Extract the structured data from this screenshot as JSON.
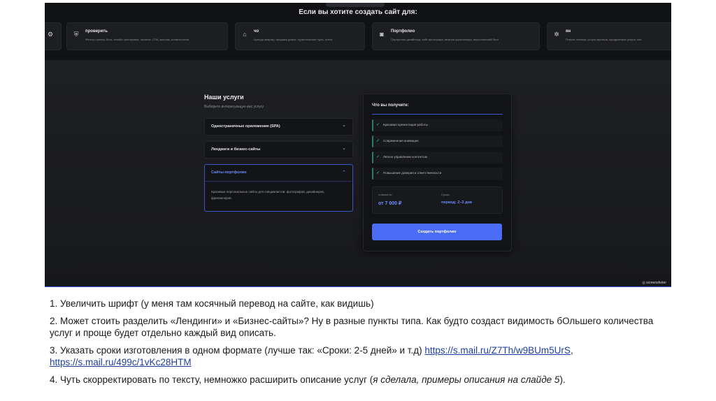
{
  "top": {
    "title": "Если вы хотите создать сайт для:",
    "categories": [
      {
        "icon": "shield-icon",
        "title": "проверить",
        "desc": "Фитнес-тренер, йога, онлайн-тренировки, питание, СПА, массаж, косметология"
      },
      {
        "icon": "house-icon",
        "title": "чо",
        "desc": "Аренда квартир, продажа домов, туристические туры, отели"
      },
      {
        "icon": "camera-icon",
        "title": "Портфолио",
        "desc": "Портфолио дизайнера, сайт фотографа, визитка фрилансера, персональный блог"
      },
      {
        "icon": "gears-icon",
        "title": "ян",
        "desc": "Ремонт техники, услуги мастера, юридические услуги, кли"
      }
    ]
  },
  "services": {
    "title": "Наши услуги",
    "subtitle": "Выберите интересующую вас услугу",
    "items": [
      {
        "label": "Одностраничные приложения (SPA)"
      },
      {
        "label": "Лендинги и бизнес-сайты"
      },
      {
        "label": "Сайты-портфолио",
        "body": "Красивые персональные сайты для специалистов: фотографов, дизайнеров, фрилансеров."
      }
    ]
  },
  "card": {
    "title": "Что вы получите:",
    "features": [
      "Красивая презентация работы",
      "Современная анимация",
      "Лёгкое управление контентом",
      "Повышение доверия и ответственности"
    ],
    "price_label": "стоимость:",
    "price_value": "от 7 000 ₽",
    "term_label": "Сроки:",
    "term_value": "период: 2–3 дня",
    "cta": "Создать портфолио"
  },
  "watermark": "◎ screenshoter",
  "notes": {
    "n1": "1. Увеличить шрифт (у меня там косячный перевод на сайте, как видишь)",
    "n2": "2. Может стоить разделить «Лендинги» и «Бизнес-сайты»? Ну в разные пункты типа. Как будто создаст видимость бОльшего количества услуг и проще будет отдельно каждый вид описать.",
    "n3_text": "3. Указать сроки изготовления в одном формате (лучше так: «Сроки: 2-5 дней» и т.д) ",
    "n3_link1": "https://s.mail.ru/Z7Th/w9BUm5UrS",
    "n3_comma": ",",
    "n3_link2": "https://s.mail.ru/499c/1vKc28HTM",
    "n4_text": "4. Чуть скорректировать по тексту, немножко расширить описание услуг (",
    "n4_italic": "я сделала, примеры описания на слайде 5",
    "n4_end": ")."
  }
}
